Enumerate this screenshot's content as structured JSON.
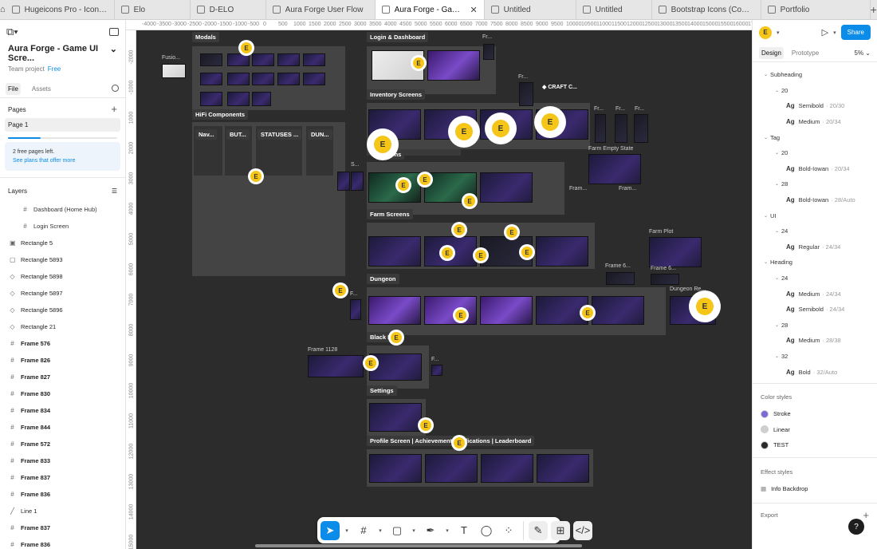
{
  "tabs": [
    {
      "label": "Hugeicons Pro - Icon Library | F"
    },
    {
      "label": "Elo"
    },
    {
      "label": "D-ELO"
    },
    {
      "label": "Aura Forge User Flow"
    },
    {
      "label": "Aura Forge - Game UI Scre",
      "active": true
    },
    {
      "label": "Untitled"
    },
    {
      "label": "Untitled"
    },
    {
      "label": "Bootstrap Icons (Community)"
    },
    {
      "label": "Portfolio"
    }
  ],
  "left": {
    "project_title": "Aura Forge - Game UI Scre...",
    "team": "Team project",
    "plan": "Free",
    "tab_file": "File",
    "tab_assets": "Assets",
    "pages_header": "Pages",
    "page_item": "Page 1",
    "pages_progress": 0.3,
    "plan_line1": "2 free pages left.",
    "plan_line2": "See plans that offer more",
    "layers_header": "Layers",
    "layers": [
      {
        "label": "Dashboard (Home Hub)",
        "child": true,
        "icon": "frame"
      },
      {
        "label": "Login Screen",
        "child": true,
        "icon": "frame"
      },
      {
        "label": "Rectangle 5",
        "icon": "image"
      },
      {
        "label": "Rectangle 5893",
        "icon": "rect"
      },
      {
        "label": "Rectangle 5898",
        "icon": "component"
      },
      {
        "label": "Rectangle 5897",
        "icon": "component"
      },
      {
        "label": "Rectangle 5896",
        "icon": "component"
      },
      {
        "label": "Rectangle 21",
        "icon": "component"
      },
      {
        "label": "Frame 576",
        "icon": "frame",
        "bold": true
      },
      {
        "label": "Frame 826",
        "icon": "frame",
        "bold": true
      },
      {
        "label": "Frame 827",
        "icon": "frame",
        "bold": true
      },
      {
        "label": "Frame 830",
        "icon": "frame",
        "bold": true
      },
      {
        "label": "Frame 834",
        "icon": "frame",
        "bold": true
      },
      {
        "label": "Frame 844",
        "icon": "frame",
        "bold": true
      },
      {
        "label": "Frame 572",
        "icon": "frame",
        "bold": true
      },
      {
        "label": "Frame 833",
        "icon": "frame",
        "bold": true
      },
      {
        "label": "Frame 837",
        "icon": "frame",
        "bold": true
      },
      {
        "label": "Frame 836",
        "icon": "frame",
        "bold": true
      },
      {
        "label": "Line 1",
        "icon": "line"
      },
      {
        "label": "Frame 837",
        "icon": "frame",
        "bold": true
      },
      {
        "label": "Frame 836",
        "icon": "frame",
        "bold": true
      }
    ]
  },
  "ruler": {
    "top": [
      "-4000",
      "-3500",
      "-3000",
      "-2500",
      "-2000",
      "-1500",
      "-1000",
      "-500",
      "0",
      "500",
      "1000",
      "1500",
      "2000",
      "2500",
      "3000",
      "3500",
      "4000",
      "4500",
      "5000",
      "5500",
      "6000",
      "6500",
      "7000",
      "7500",
      "8000",
      "8500",
      "9000",
      "9500",
      "10000",
      "10500",
      "11000",
      "11500",
      "12000",
      "12500",
      "13000",
      "13500",
      "14000",
      "15000",
      "15500",
      "16000",
      "17000"
    ],
    "left": [
      "-2000",
      "-1000",
      "1000",
      "2000",
      "3000",
      "4000",
      "5000",
      "6000",
      "7000",
      "8000",
      "9000",
      "10000",
      "11000",
      "12000",
      "13000",
      "14000",
      "15000"
    ]
  },
  "canvas": {
    "sections": {
      "modals": "Modals",
      "login": "Login & Dashboard",
      "hifi": "HiFi Components",
      "nav": "Nav...",
      "but": "BUT...",
      "statuses": "STATUSES ...",
      "dun": "DUN...",
      "inventory": "Inventory Screens",
      "craft_screens": "...eens",
      "farm": "Farm Screens",
      "dungeon": "Dungeon",
      "black": "Black M...",
      "settings": "Settings",
      "profile": "Profile Screen | Achievements | ...fications | Leaderboard"
    },
    "labels": {
      "fusio": "Fusio...",
      "fr1": "Fr...",
      "fr2": "Fr...",
      "craft": "◆ CRAFT C...",
      "fr3": "Fr...",
      "fr4": "Fr...",
      "fr5": "Fr...",
      "farm_empty": "Farm Empty State",
      "fram1": "Fram...",
      "fram2": "Fram...",
      "s": "S...",
      "farm_plot": "Farm Plot",
      "frame6a": "Frame 6...",
      "frame6b": "Frame 6...",
      "f1": "F...",
      "dungeon_re": "Dungeon Re...",
      "frame1128": "Frame 1128",
      "f2": "F..."
    },
    "cursor_letter": "E"
  },
  "right": {
    "avatar_letter": "E",
    "share": "Share",
    "tab_design": "Design",
    "tab_prototype": "Prototype",
    "zoom": "5%",
    "text_styles": [
      {
        "level": 0,
        "label": "Subheading",
        "arrow": true
      },
      {
        "level": 1,
        "label": "20",
        "arrow": true
      },
      {
        "level": 2,
        "label": "Semibold",
        "detail": "· 20/30",
        "ag": true
      },
      {
        "level": 2,
        "label": "Medium",
        "detail": "· 20/34",
        "ag": true
      },
      {
        "level": 0,
        "label": "Tag",
        "arrow": true
      },
      {
        "level": 1,
        "label": "20",
        "arrow": true
      },
      {
        "level": 2,
        "label": "Bold-Iowan",
        "detail": "· 20/34",
        "ag": true
      },
      {
        "level": 1,
        "label": "28",
        "arrow": true
      },
      {
        "level": 2,
        "label": "Bold-Iowan",
        "detail": "· 28/Auto",
        "ag": true
      },
      {
        "level": 0,
        "label": "UI",
        "arrow": true
      },
      {
        "level": 1,
        "label": "24",
        "arrow": true
      },
      {
        "level": 2,
        "label": "Regular",
        "detail": "· 24/34",
        "ag": true
      },
      {
        "level": 0,
        "label": "Heading",
        "arrow": true
      },
      {
        "level": 1,
        "label": "24",
        "arrow": true
      },
      {
        "level": 2,
        "label": "Medium",
        "detail": "· 24/34",
        "ag": true
      },
      {
        "level": 2,
        "label": "Semibold",
        "detail": "· 24/34",
        "ag": true
      },
      {
        "level": 1,
        "label": "28",
        "arrow": true
      },
      {
        "level": 2,
        "label": "Medium",
        "detail": "· 28/38",
        "ag": true
      },
      {
        "level": 1,
        "label": "32",
        "arrow": true
      },
      {
        "level": 2,
        "label": "Bold",
        "detail": "· 32/Auto",
        "ag": true
      }
    ],
    "color_styles_header": "Color styles",
    "color_styles": [
      {
        "label": "Stroke",
        "color": "#7a6ad8"
      },
      {
        "label": "Linear",
        "color": "#cfcfcf"
      },
      {
        "label": "TEST",
        "color": "#2a2a2a"
      }
    ],
    "effect_styles_header": "Effect styles",
    "effect_styles": [
      {
        "label": "Info Backdrop"
      }
    ],
    "export_header": "Export",
    "help": "?"
  },
  "colors": {
    "accent": "#0c8ce9",
    "canvas": "#2c2c2c",
    "cursor": "#f5c518"
  }
}
